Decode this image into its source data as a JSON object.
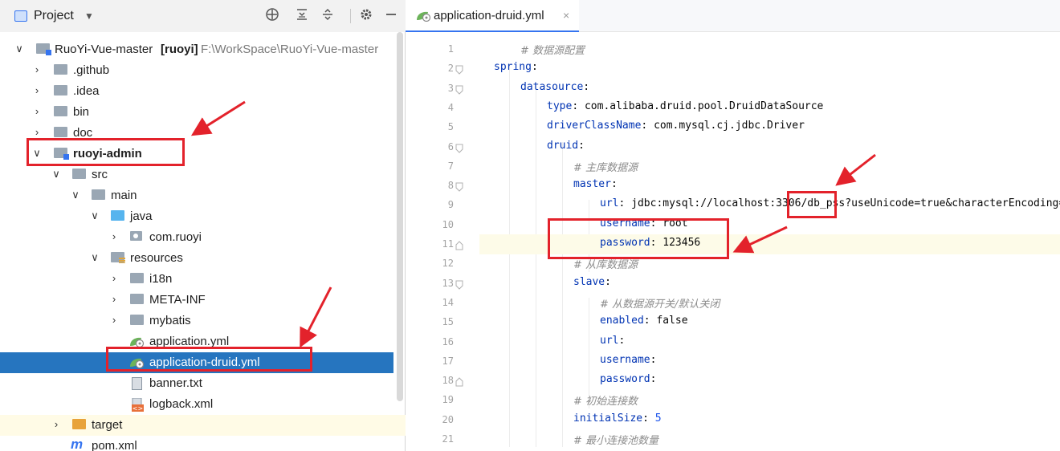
{
  "project_panel": {
    "title": "Project",
    "tools": [
      "crosshair-icon",
      "collapse-all-icon",
      "expand-all-icon",
      "gear-icon",
      "minimize-icon"
    ]
  },
  "tree": [
    {
      "label": "RuoYi-Vue-master",
      "bold_suffix": "[ruoyi]",
      "path": "F:\\WorkSpace\\RuoYi-Vue-master",
      "depth": 0,
      "chevron": "down",
      "icon": "module-folder"
    },
    {
      "label": ".github",
      "depth": 1,
      "chevron": "right",
      "icon": "folder"
    },
    {
      "label": ".idea",
      "depth": 1,
      "chevron": "right",
      "icon": "folder"
    },
    {
      "label": "bin",
      "depth": 1,
      "chevron": "right",
      "icon": "folder"
    },
    {
      "label": "doc",
      "depth": 1,
      "chevron": "right",
      "icon": "folder"
    },
    {
      "label": "ruoyi-admin",
      "depth": 1,
      "chevron": "down",
      "icon": "module-folder",
      "bold": true
    },
    {
      "label": "src",
      "depth": 2,
      "chevron": "down",
      "icon": "folder"
    },
    {
      "label": "main",
      "depth": 3,
      "chevron": "down",
      "icon": "folder"
    },
    {
      "label": "java",
      "depth": 4,
      "chevron": "down",
      "icon": "java-folder"
    },
    {
      "label": "com.ruoyi",
      "depth": 5,
      "chevron": "right",
      "icon": "package"
    },
    {
      "label": "resources",
      "depth": 4,
      "chevron": "down",
      "icon": "resources-folder"
    },
    {
      "label": "i18n",
      "depth": 5,
      "chevron": "right",
      "icon": "folder"
    },
    {
      "label": "META-INF",
      "depth": 5,
      "chevron": "right",
      "icon": "folder"
    },
    {
      "label": "mybatis",
      "depth": 5,
      "chevron": "right",
      "icon": "folder"
    },
    {
      "label": "application.yml",
      "depth": 5,
      "chevron": "none",
      "icon": "yml-file"
    },
    {
      "label": "application-druid.yml",
      "depth": 5,
      "chevron": "none",
      "icon": "yml-file",
      "selected": true
    },
    {
      "label": "banner.txt",
      "depth": 5,
      "chevron": "none",
      "icon": "txt-file"
    },
    {
      "label": "logback.xml",
      "depth": 5,
      "chevron": "none",
      "icon": "xml-file"
    },
    {
      "label": "target",
      "depth": 2,
      "chevron": "right",
      "icon": "target-folder"
    },
    {
      "label": "pom.xml",
      "depth": 2,
      "chevron": "none",
      "icon": "maven-file"
    }
  ],
  "editor": {
    "tab_label": "application-druid.yml",
    "tab_close": "×",
    "line_numbers": [
      "1",
      "2",
      "3",
      "4",
      "5",
      "6",
      "7",
      "8",
      "9",
      "10",
      "11",
      "12",
      "13",
      "14",
      "15",
      "16",
      "17",
      "18",
      "19",
      "20",
      "21"
    ],
    "lines": [
      {
        "indent": 1,
        "comment": "# 数据源配置"
      },
      {
        "indent": 0,
        "key": "spring",
        "sep": ":"
      },
      {
        "indent": 1,
        "key": "datasource",
        "sep": ":"
      },
      {
        "indent": 2,
        "key": "type",
        "sep": ": ",
        "value": "com.alibaba.druid.pool.DruidDataSource"
      },
      {
        "indent": 2,
        "key": "driverClassName",
        "sep": ": ",
        "value": "com.mysql.cj.jdbc.Driver"
      },
      {
        "indent": 2,
        "key": "druid",
        "sep": ":"
      },
      {
        "indent": 3,
        "comment": "# 主库数据源"
      },
      {
        "indent": 3,
        "key": "master",
        "sep": ":"
      },
      {
        "indent": 4,
        "key": "url",
        "sep": ": ",
        "value": "jdbc:mysql://localhost:3306/db_pss?useUnicode=true&characterEncoding="
      },
      {
        "indent": 4,
        "key": "username",
        "sep": ": ",
        "value": "root"
      },
      {
        "indent": 4,
        "key": "password",
        "sep": ": ",
        "value": "123456"
      },
      {
        "indent": 3,
        "comment": "# 从库数据源"
      },
      {
        "indent": 3,
        "key": "slave",
        "sep": ":"
      },
      {
        "indent": 4,
        "comment": "# 从数据源开关/默认关闭"
      },
      {
        "indent": 4,
        "key": "enabled",
        "sep": ": ",
        "value": "false",
        "value_kind": "keyword"
      },
      {
        "indent": 4,
        "key": "url",
        "sep": ":"
      },
      {
        "indent": 4,
        "key": "username",
        "sep": ":"
      },
      {
        "indent": 4,
        "key": "password",
        "sep": ":"
      },
      {
        "indent": 3,
        "comment": "# 初始连接数"
      },
      {
        "indent": 3,
        "key": "initialSize",
        "sep": ": ",
        "value": "5",
        "value_kind": "number"
      },
      {
        "indent": 3,
        "comment": "# 最小连接池数量"
      }
    ],
    "current_line": 11
  },
  "colors": {
    "selection": "#2675bf",
    "annotation": "#e3222b",
    "key": "#0033b3",
    "value": "#067d17",
    "number": "#1750eb",
    "comment": "#8c8c8c"
  }
}
